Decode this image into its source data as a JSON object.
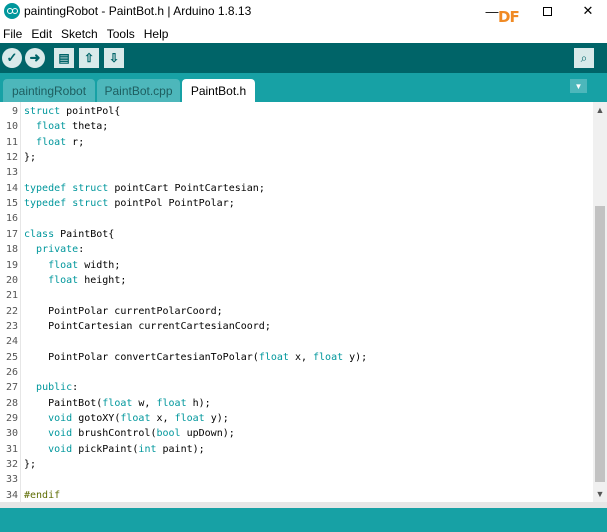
{
  "window": {
    "title": "paintingRobot - PaintBot.h | Arduino 1.8.13",
    "logo_text": "DF",
    "minimize": "—",
    "close": "✕"
  },
  "menu": [
    "File",
    "Edit",
    "Sketch",
    "Tools",
    "Help"
  ],
  "toolbar": {
    "verify_icon": "✓",
    "upload_icon": "➜",
    "new_icon": "▤",
    "open_icon": "⇧",
    "save_icon": "⇩",
    "serial_icon": "⌕"
  },
  "tabs": [
    "paintingRobot",
    "PaintBot.cpp",
    "PaintBot.h"
  ],
  "tab_menu_icon": "▼",
  "scroll": {
    "up": "▲",
    "down": "▼"
  },
  "code": [
    {
      "n": "9",
      "t": "struct pointPol{"
    },
    {
      "n": "10",
      "t": "  float theta;"
    },
    {
      "n": "11",
      "t": "  float r;"
    },
    {
      "n": "12",
      "t": "};"
    },
    {
      "n": "13",
      "t": ""
    },
    {
      "n": "14",
      "t": "typedef struct pointCart PointCartesian;"
    },
    {
      "n": "15",
      "t": "typedef struct pointPol PointPolar;"
    },
    {
      "n": "16",
      "t": ""
    },
    {
      "n": "17",
      "t": "class PaintBot{"
    },
    {
      "n": "18",
      "t": "  private:"
    },
    {
      "n": "19",
      "t": "    float width;"
    },
    {
      "n": "20",
      "t": "    float height;"
    },
    {
      "n": "21",
      "t": ""
    },
    {
      "n": "22",
      "t": "    PointPolar currentPolarCoord;"
    },
    {
      "n": "23",
      "t": "    PointCartesian currentCartesianCoord;"
    },
    {
      "n": "24",
      "t": ""
    },
    {
      "n": "25",
      "t": "    PointPolar convertCartesianToPolar(float x, float y);"
    },
    {
      "n": "26",
      "t": ""
    },
    {
      "n": "27",
      "t": "  public:"
    },
    {
      "n": "28",
      "t": "    PaintBot(float w, float h);"
    },
    {
      "n": "29",
      "t": "    void gotoXY(float x, float y);"
    },
    {
      "n": "30",
      "t": "    void brushControl(bool upDown);"
    },
    {
      "n": "31",
      "t": "    void pickPaint(int paint);"
    },
    {
      "n": "32",
      "t": "};"
    },
    {
      "n": "33",
      "t": ""
    },
    {
      "n": "34",
      "t": "#endif"
    }
  ],
  "colors": {
    "toolbar": "#006468",
    "tabbar": "#17a1a5",
    "keyword": "#00979c",
    "directive": "#5e6d03",
    "logo": "#f08a24"
  }
}
